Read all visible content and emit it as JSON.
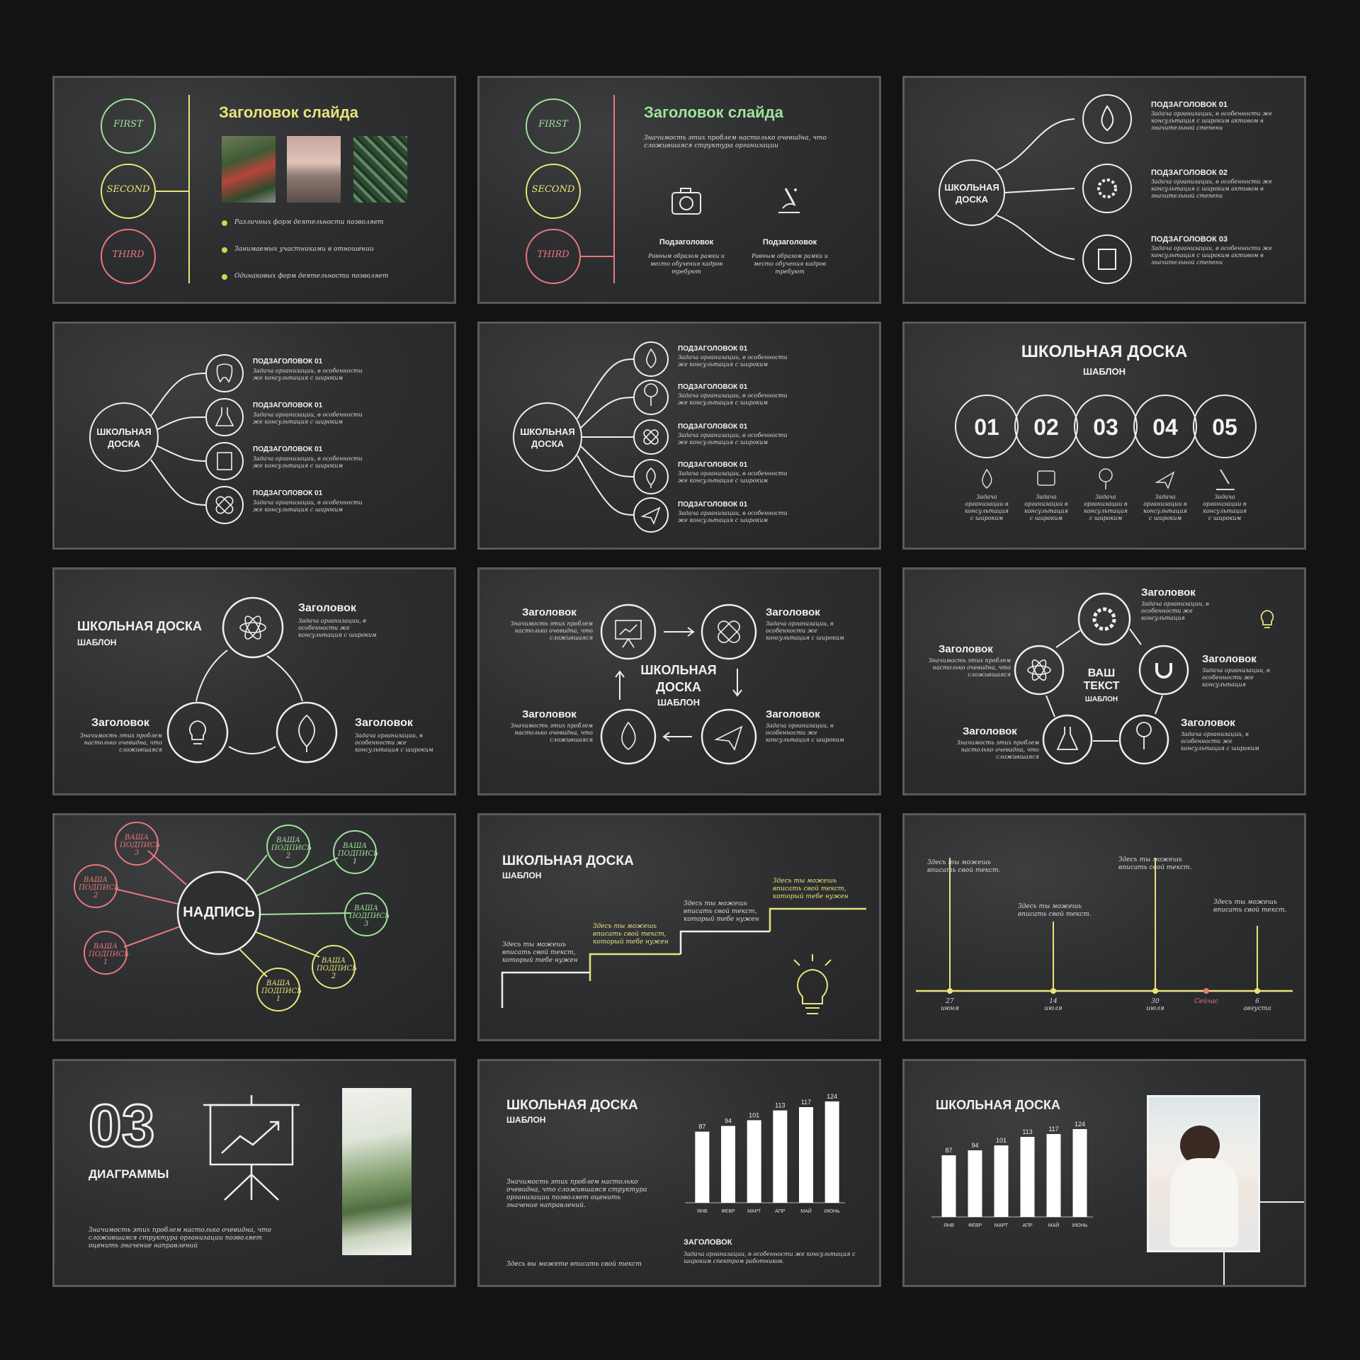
{
  "colors": {
    "bg": "#131214",
    "board": "#2e2f31",
    "chalk": "#eeeeee",
    "yellow": "#e9e47a",
    "green": "#9fe39a",
    "red": "#e8787a"
  },
  "s1": {
    "title": "Заголовок слайда",
    "circles": [
      "FIRST",
      "SECOND",
      "THIRD"
    ],
    "bullets": [
      "Различных форм деятельности позволяет",
      "Занимаемых участниками в отношении",
      "Одинаковых форм деятельности позволяет"
    ]
  },
  "s2": {
    "title": "Заголовок слайда",
    "circles": [
      "FIRST",
      "SECOND",
      "THIRD"
    ],
    "text": "Значимость этих проблем настолько очевидна, что сложившаяся структура организации",
    "items": [
      {
        "title": "Подзаголовок",
        "text": "Равным образом рамки и место обучения кадров требуют",
        "icon": "camera-icon"
      },
      {
        "title": "Подзаголовок",
        "text": "Равным образом рамки и место обучения кадров требуют",
        "icon": "microscope-icon"
      }
    ]
  },
  "s3": {
    "center": "ШКОЛЬНАЯ ДОСКА",
    "items": [
      {
        "title": "ПОДЗАГОЛОВОК 01",
        "text": "Задача организации, в особенности же консультация с широким активом в значительной степени",
        "icon": "flame-icon"
      },
      {
        "title": "ПОДЗАГОЛОВОК 02",
        "text": "Задача организации, в особенности же консультация с широким активом в значительной степени",
        "icon": "gear-icon"
      },
      {
        "title": "ПОДЗАГОЛОВОК 03",
        "text": "Задача организации, в особенности же консультация с широким активом в значительной степени",
        "icon": "book-icon"
      }
    ]
  },
  "s4": {
    "center": "ШКОЛЬНАЯ ДОСКА",
    "items": [
      {
        "title": "ПОДЗАГОЛОВОК 01",
        "text": "Задача организации, в особенности же консультация с широким",
        "icon": "tooth-icon"
      },
      {
        "title": "ПОДЗАГОЛОВОК 01",
        "text": "Задача организации, в особенности же консультация с широким",
        "icon": "flask-icon"
      },
      {
        "title": "ПОДЗАГОЛОВОК 01",
        "text": "Задача организации, в особенности же консультация с широким",
        "icon": "clipboard-icon"
      },
      {
        "title": "ПОДЗАГОЛОВОК 01",
        "text": "Задача организации, в особенности же консультация с широким",
        "icon": "bandage-icon"
      }
    ]
  },
  "s5": {
    "center": "ШКОЛЬНАЯ ДОСКА",
    "items": [
      {
        "title": "ПОДЗАГОЛОВОК 01",
        "text": "Задача организации, в особенности же консультация с широким",
        "icon": "flame-icon"
      },
      {
        "title": "ПОДЗАГОЛОВОК 01",
        "text": "Задача организации, в особенности же консультация с широким",
        "icon": "tree-icon"
      },
      {
        "title": "ПОДЗАГОЛОВОК 01",
        "text": "Задача организации, в особенности же консультация с широким",
        "icon": "bandage-icon"
      },
      {
        "title": "ПОДЗАГОЛОВОК 01",
        "text": "Задача организации, в особенности же консультация с широким",
        "icon": "leaf-icon"
      },
      {
        "title": "ПОДЗАГОЛОВОК 01",
        "text": "Задача организации, в особенности же консультация с широким",
        "icon": "paper-plane-icon"
      }
    ]
  },
  "s6": {
    "title": "ШКОЛЬНАЯ ДОСКА",
    "subtitle": "ШАБЛОН",
    "numbers": [
      "01",
      "02",
      "03",
      "04",
      "05"
    ],
    "text": "Задача организации в консультация с широким",
    "icons": [
      "flame-icon",
      "camera-icon",
      "tree-icon",
      "paper-plane-icon",
      "microscope-icon"
    ]
  },
  "s7": {
    "title": "ШКОЛЬНАЯ ДОСКА",
    "subtitle": "ШАБЛОН",
    "items": [
      {
        "title": "Заголовок",
        "text": "Задача организации, в особенности же консультация с широким",
        "icon": "atom-icon"
      },
      {
        "title": "Заголовок",
        "text": "Задача организации, в особенности же консультация с широким",
        "icon": "leaf-icon"
      },
      {
        "title": "Заголовок",
        "text": "Значимость этих проблем настолько очевидна, что сложившаяся",
        "icon": "lightbulb-icon"
      }
    ]
  },
  "s8": {
    "center1": "ШКОЛЬНАЯ",
    "center2": "ДОСКА",
    "center3": "ШАБЛОН",
    "items": [
      {
        "title": "Заголовок",
        "text": "Значимость этих проблем настолько очевидна, что сложившаяся",
        "icon": "presentation-icon"
      },
      {
        "title": "Заголовок",
        "text": "Задача организации, в особенности же консультация с широким",
        "icon": "bandage-icon"
      },
      {
        "title": "Заголовок",
        "text": "Задача организации, в особенности же консультация с широким",
        "icon": "paper-plane-icon"
      },
      {
        "title": "Заголовок",
        "text": "Значимость этих проблем настолько очевидна, что сложившаяся",
        "icon": "flame-icon"
      }
    ]
  },
  "s9": {
    "center1": "ВАШ",
    "center2": "ТЕКСТ",
    "center3": "ШАБЛОН",
    "items": [
      {
        "title": "Заголовок",
        "text": "Задача организации, в особенности же консультация",
        "icon": "gear-icon"
      },
      {
        "title": "Заголовок",
        "text": "Задача организации, в особенности же консультация",
        "icon": "magnet-icon"
      },
      {
        "title": "Заголовок",
        "text": "Задача организации, в особенности же консультация с широким",
        "icon": "tree-icon"
      },
      {
        "title": "Заголовок",
        "text": "Значимость этих проблем настолько очевидна, что сложившаяся",
        "icon": "flask-icon"
      },
      {
        "title": "Заголовок",
        "text": "Значимость этих проблем настолько очевидна, что сложившаяся",
        "icon": "atom-icon"
      }
    ]
  },
  "s10": {
    "center": "НАДПИСЬ",
    "red": [
      "ВАША ПОДПИСЬ 3",
      "ВАША ПОДПИСЬ 2",
      "ВАША ПОДПИСЬ 1"
    ],
    "green": [
      "ВАША ПОДПИСЬ 2",
      "ВАША ПОДПИСЬ 1",
      "ВАША ПОДПИСЬ 3"
    ],
    "yellow": [
      "ВАША ПОДПИСЬ 2",
      "ВАША ПОДПИСЬ 1"
    ]
  },
  "s11": {
    "title": "ШКОЛЬНАЯ ДОСКА",
    "subtitle": "ШАБЛОН",
    "steps": [
      "Здесь ты можешь вписать свой текст, который тебе нужен",
      "Здесь ты можешь вписать свой текст, который тебе нужен",
      "Здесь ты можешь вписать свой текст, который тебе нужен",
      "Здесь ты можешь вписать свой текст, который тебе нужен"
    ]
  },
  "s12": {
    "notes": [
      "Здесь ты можешь вписать свой текст.",
      "Здесь ты можешь вписать свой текст.",
      "Здесь ты можешь вписать свой текст.",
      "Здесь ты можешь вписать свой текст."
    ],
    "dates": [
      {
        "d": "27",
        "m": "июня"
      },
      {
        "d": "14",
        "m": "июля"
      },
      {
        "d": "30",
        "m": "июля"
      },
      {
        "d": "Сейчас",
        "m": ""
      },
      {
        "d": "6",
        "m": "августа"
      }
    ]
  },
  "s13": {
    "number": "03",
    "title": "ДИАГРАММЫ",
    "text": "Значимость этих проблем настолько очевидна, что сложившаяся структура организации позволяет оценить значение направлений"
  },
  "s14": {
    "title": "ШКОЛЬНАЯ ДОСКА",
    "subtitle": "ШАБЛОН",
    "text": "Значимость этих проблем настолько очевидна, что сложившаяся структура организации позволяет оценить значение направлений.",
    "foot": "Здесь вы можете вписать свой текст",
    "heading": "ЗАГОЛОВОК",
    "heading_text": "Задача организации, в особенности же консультация с широким спектром работников."
  },
  "s15": {
    "title": "ШКОЛЬНАЯ ДОСКА"
  },
  "chart_data": [
    {
      "type": "bar",
      "categories": [
        "ЯНВ",
        "ФЕВР",
        "МАРТ",
        "АПР",
        "МАЙ",
        "ИЮНЬ"
      ],
      "values": [
        87,
        94,
        101,
        113,
        117,
        124
      ]
    },
    {
      "type": "bar",
      "categories": [
        "ЯНВ",
        "ФЕВР",
        "МАРТ",
        "АПР",
        "МАЙ",
        "ИЮНЬ"
      ],
      "values": [
        87,
        94,
        101,
        113,
        117,
        124
      ]
    }
  ]
}
